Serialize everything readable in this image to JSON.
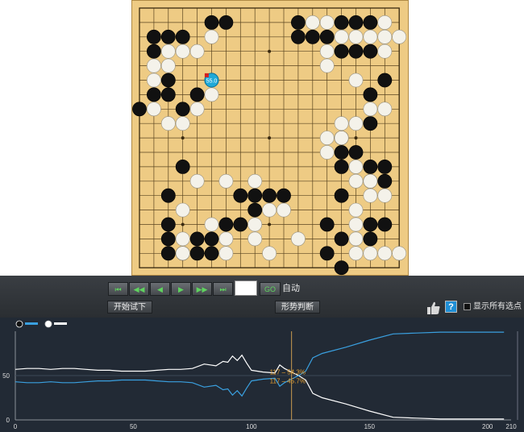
{
  "board": {
    "size": 19,
    "black": [
      [
        5,
        1
      ],
      [
        6,
        1
      ],
      [
        11,
        1
      ],
      [
        14,
        1
      ],
      [
        15,
        1
      ],
      [
        16,
        1
      ],
      [
        1,
        2
      ],
      [
        2,
        2
      ],
      [
        3,
        2
      ],
      [
        11,
        2
      ],
      [
        12,
        2
      ],
      [
        13,
        2
      ],
      [
        1,
        3
      ],
      [
        14,
        3
      ],
      [
        15,
        3
      ],
      [
        16,
        3
      ],
      [
        2,
        5
      ],
      [
        17,
        5
      ],
      [
        1,
        6
      ],
      [
        2,
        6
      ],
      [
        4,
        6
      ],
      [
        16,
        6
      ],
      [
        0,
        7
      ],
      [
        3,
        7
      ],
      [
        16,
        8
      ],
      [
        14,
        9
      ],
      [
        14,
        10
      ],
      [
        15,
        10
      ],
      [
        3,
        11
      ],
      [
        14,
        11
      ],
      [
        16,
        11
      ],
      [
        17,
        11
      ],
      [
        16,
        12
      ],
      [
        17,
        12
      ],
      [
        2,
        13
      ],
      [
        7,
        13
      ],
      [
        8,
        13
      ],
      [
        9,
        13
      ],
      [
        10,
        13
      ],
      [
        14,
        13
      ],
      [
        8,
        14
      ],
      [
        2,
        15
      ],
      [
        6,
        15
      ],
      [
        7,
        15
      ],
      [
        13,
        15
      ],
      [
        16,
        15
      ],
      [
        17,
        15
      ],
      [
        2,
        16
      ],
      [
        4,
        16
      ],
      [
        5,
        16
      ],
      [
        14,
        16
      ],
      [
        16,
        16
      ],
      [
        2,
        17
      ],
      [
        3,
        17
      ],
      [
        4,
        17
      ],
      [
        5,
        17
      ],
      [
        13,
        17
      ],
      [
        14,
        18
      ]
    ],
    "white": [
      [
        12,
        1
      ],
      [
        13,
        1
      ],
      [
        17,
        1
      ],
      [
        5,
        2
      ],
      [
        14,
        2
      ],
      [
        15,
        2
      ],
      [
        16,
        2
      ],
      [
        17,
        2
      ],
      [
        18,
        2
      ],
      [
        2,
        3
      ],
      [
        3,
        3
      ],
      [
        4,
        3
      ],
      [
        13,
        3
      ],
      [
        17,
        3
      ],
      [
        1,
        4
      ],
      [
        2,
        4
      ],
      [
        13,
        4
      ],
      [
        1,
        5
      ],
      [
        15,
        5
      ],
      [
        5,
        6
      ],
      [
        1,
        7
      ],
      [
        4,
        7
      ],
      [
        16,
        7
      ],
      [
        17,
        7
      ],
      [
        2,
        8
      ],
      [
        3,
        8
      ],
      [
        14,
        8
      ],
      [
        15,
        8
      ],
      [
        13,
        9
      ],
      [
        14,
        9
      ],
      [
        13,
        10
      ],
      [
        15,
        11
      ],
      [
        15,
        12
      ],
      [
        16,
        12
      ],
      [
        4,
        12
      ],
      [
        6,
        12
      ],
      [
        8,
        12
      ],
      [
        3,
        14
      ],
      [
        9,
        14
      ],
      [
        10,
        14
      ],
      [
        15,
        14
      ],
      [
        16,
        13
      ],
      [
        17,
        13
      ],
      [
        15,
        15
      ],
      [
        5,
        15
      ],
      [
        8,
        15
      ],
      [
        3,
        16
      ],
      [
        6,
        16
      ],
      [
        8,
        16
      ],
      [
        11,
        16
      ],
      [
        15,
        16
      ],
      [
        3,
        17
      ],
      [
        6,
        17
      ],
      [
        9,
        17
      ],
      [
        15,
        17
      ],
      [
        16,
        17
      ],
      [
        17,
        17
      ],
      [
        18,
        17
      ]
    ],
    "marker": {
      "col": 5,
      "row": 5,
      "label": "55.0"
    }
  },
  "toolbar": {
    "nav_buttons": [
      "⏮",
      "◀◀",
      "◀",
      "▶",
      "▶▶",
      "⏭"
    ],
    "move_input_value": "",
    "go_label": "GO",
    "auto_label": "自动",
    "start_trial_label": "开始试下",
    "situation_label": "形势判断",
    "help_label": "?",
    "show_all_label": "显示所有选点"
  },
  "chart_data": {
    "type": "line",
    "ylim": [
      0,
      100
    ],
    "xlim": [
      0,
      210
    ],
    "xticks": [
      0,
      50,
      100,
      150,
      200,
      210
    ],
    "yticks": [
      0,
      50
    ],
    "current_move": 117,
    "annotations": [
      "117 – 54.3%",
      "117 – 45.7%"
    ],
    "legend": [
      {
        "name": "",
        "color": "#111111"
      },
      {
        "name": "",
        "color": "#ffffff"
      }
    ],
    "series": [
      {
        "color": "#ffffff",
        "points": [
          [
            0,
            57
          ],
          [
            5,
            58
          ],
          [
            10,
            58
          ],
          [
            15,
            57
          ],
          [
            20,
            58
          ],
          [
            25,
            58
          ],
          [
            30,
            57
          ],
          [
            35,
            56
          ],
          [
            40,
            56
          ],
          [
            45,
            55
          ],
          [
            50,
            55
          ],
          [
            55,
            55
          ],
          [
            60,
            56
          ],
          [
            65,
            57
          ],
          [
            70,
            57
          ],
          [
            75,
            58
          ],
          [
            80,
            63
          ],
          [
            85,
            61
          ],
          [
            88,
            66
          ],
          [
            90,
            65
          ],
          [
            92,
            72
          ],
          [
            94,
            67
          ],
          [
            96,
            73
          ],
          [
            98,
            64
          ],
          [
            100,
            56
          ],
          [
            105,
            54
          ],
          [
            110,
            53
          ],
          [
            112,
            62
          ],
          [
            114,
            58
          ],
          [
            117,
            54
          ],
          [
            120,
            50
          ],
          [
            123,
            45
          ],
          [
            126,
            30
          ],
          [
            130,
            25
          ],
          [
            140,
            18
          ],
          [
            150,
            10
          ],
          [
            160,
            3
          ],
          [
            170,
            2
          ],
          [
            180,
            1
          ],
          [
            190,
            1
          ],
          [
            200,
            1
          ],
          [
            207,
            1
          ]
        ]
      },
      {
        "color": "#3aa0e0",
        "points": [
          [
            0,
            43
          ],
          [
            5,
            42
          ],
          [
            10,
            42
          ],
          [
            15,
            43
          ],
          [
            20,
            42
          ],
          [
            25,
            42
          ],
          [
            30,
            43
          ],
          [
            35,
            44
          ],
          [
            40,
            44
          ],
          [
            45,
            45
          ],
          [
            50,
            45
          ],
          [
            55,
            45
          ],
          [
            60,
            44
          ],
          [
            65,
            43
          ],
          [
            70,
            43
          ],
          [
            75,
            42
          ],
          [
            80,
            37
          ],
          [
            85,
            39
          ],
          [
            88,
            34
          ],
          [
            90,
            35
          ],
          [
            92,
            28
          ],
          [
            94,
            33
          ],
          [
            96,
            27
          ],
          [
            98,
            36
          ],
          [
            100,
            44
          ],
          [
            105,
            46
          ],
          [
            110,
            47
          ],
          [
            112,
            38
          ],
          [
            114,
            42
          ],
          [
            117,
            46
          ],
          [
            120,
            50
          ],
          [
            123,
            55
          ],
          [
            126,
            70
          ],
          [
            130,
            75
          ],
          [
            140,
            82
          ],
          [
            150,
            90
          ],
          [
            160,
            97
          ],
          [
            170,
            98
          ],
          [
            180,
            99
          ],
          [
            190,
            99
          ],
          [
            200,
            99
          ],
          [
            207,
            99
          ]
        ]
      }
    ]
  }
}
